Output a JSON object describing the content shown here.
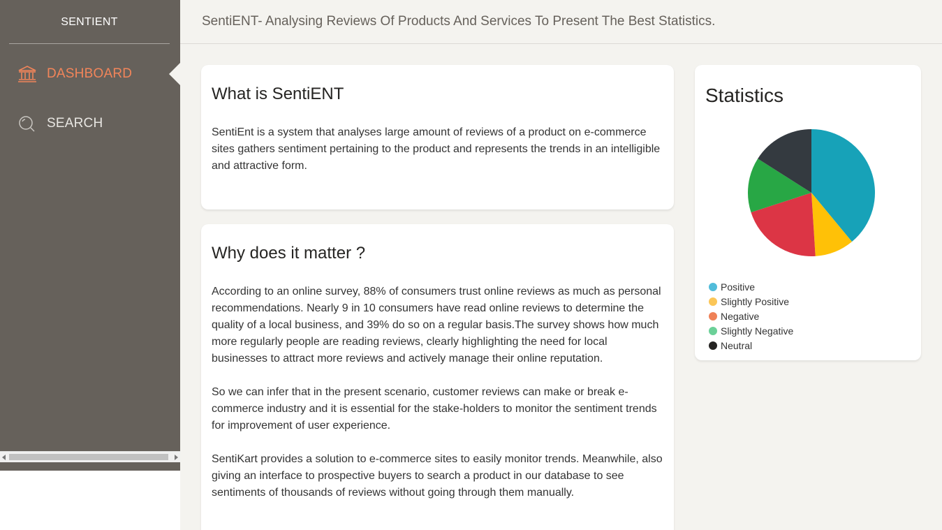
{
  "sidebar": {
    "brand": "SENTIENT",
    "items": [
      {
        "label": "DASHBOARD",
        "icon": "bank-icon",
        "active": true
      },
      {
        "label": "SEARCH",
        "icon": "search-icon",
        "active": false
      }
    ]
  },
  "header": {
    "title": "SentiENT- Analysing Reviews Of Products And Services To Present The Best Statistics."
  },
  "cards": {
    "what": {
      "title": "What is SentiENT",
      "body": "SentiEnt is a system that analyses large amount of reviews of a product on e-commerce sites gathers sentiment pertaining to the product and represents the trends in an intelligible and attractive form."
    },
    "why": {
      "title": "Why does it matter ?",
      "p1": "According to an online survey, 88% of consumers trust online reviews as much as personal recommendations. Nearly 9 in 10 consumers have read online reviews to determine the quality of a local business, and 39% do so on a regular basis.The survey shows how much more regularly people are reading reviews, clearly highlighting the need for local businesses to attract more reviews and actively manage their online reputation.",
      "p2": "So we can infer that in the present scenario, customer reviews can make or break e-commerce industry and it is essential for the stake-holders to monitor the sentiment trends for improvement of user experience.",
      "p3": "SentiKart provides a solution to e-commerce sites to easily monitor trends. Meanwhile, also giving an interface to prospective buyers to search a product in our database to see sentiments of thousands of reviews without going through them manually."
    },
    "stats": {
      "title": "Statistics"
    }
  },
  "colors": {
    "sidebar_bg": "#66615b",
    "accent": "#f2855a",
    "page_bg": "#f4f3ef"
  },
  "chart_data": {
    "type": "pie",
    "title": "",
    "slices": [
      {
        "label": "Positive",
        "value": 39,
        "color": "#17a2b8"
      },
      {
        "label": "Slightly Positive",
        "value": 10,
        "color": "#ffc107"
      },
      {
        "label": "Negative",
        "value": 21,
        "color": "#dc3545"
      },
      {
        "label": "Slightly Negative",
        "value": 14,
        "color": "#28a745"
      },
      {
        "label": "Neutral",
        "value": 16,
        "color": "#343a40"
      }
    ],
    "legend": [
      {
        "label": "Positive",
        "color": "#51bcda"
      },
      {
        "label": "Slightly Positive",
        "color": "#fbc658"
      },
      {
        "label": "Negative",
        "color": "#ef8157"
      },
      {
        "label": "Slightly Negative",
        "color": "#6bd098"
      },
      {
        "label": "Neutral",
        "color": "#252422"
      }
    ],
    "legend_placement": "bottom-left"
  }
}
